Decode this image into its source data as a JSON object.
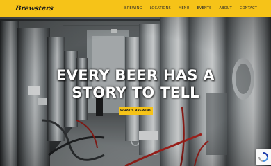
{
  "brand": {
    "logo_text": "Brewsters"
  },
  "nav": {
    "items": [
      {
        "label": "BREWING"
      },
      {
        "label": "LOCATIONS"
      },
      {
        "label": "MENU"
      },
      {
        "label": "EVENTS"
      },
      {
        "label": "ABOUT"
      },
      {
        "label": "CONTACT"
      }
    ]
  },
  "hero": {
    "headline_line1": "EVERY BEER HAS A",
    "headline_line2": "STORY TO TELL",
    "cta_label": "WHAT'S BREWING"
  },
  "colors": {
    "accent": "#f6c318",
    "headline": "#ffffff"
  },
  "badge": {
    "icon": "recaptcha-icon"
  }
}
